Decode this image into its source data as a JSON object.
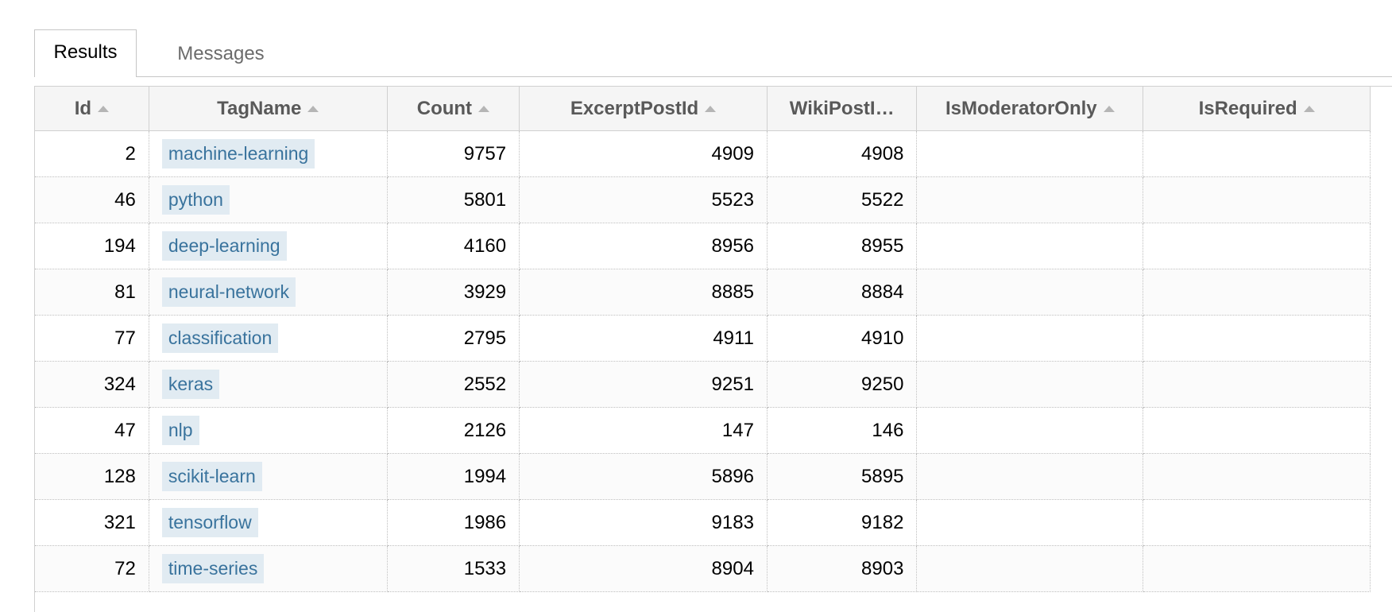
{
  "tabs": [
    {
      "label": "Results",
      "active": true
    },
    {
      "label": "Messages",
      "active": false
    }
  ],
  "columns": [
    "Id",
    "TagName",
    "Count",
    "ExcerptPostId",
    "WikiPostI…",
    "IsModeratorOnly",
    "IsRequired"
  ],
  "rows": [
    {
      "id": "2",
      "tag": "machine-learning",
      "count": "9757",
      "excerpt": "4909",
      "wiki": "4908",
      "mod": "",
      "req": ""
    },
    {
      "id": "46",
      "tag": "python",
      "count": "5801",
      "excerpt": "5523",
      "wiki": "5522",
      "mod": "",
      "req": ""
    },
    {
      "id": "194",
      "tag": "deep-learning",
      "count": "4160",
      "excerpt": "8956",
      "wiki": "8955",
      "mod": "",
      "req": ""
    },
    {
      "id": "81",
      "tag": "neural-network",
      "count": "3929",
      "excerpt": "8885",
      "wiki": "8884",
      "mod": "",
      "req": ""
    },
    {
      "id": "77",
      "tag": "classification",
      "count": "2795",
      "excerpt": "4911",
      "wiki": "4910",
      "mod": "",
      "req": ""
    },
    {
      "id": "324",
      "tag": "keras",
      "count": "2552",
      "excerpt": "9251",
      "wiki": "9250",
      "mod": "",
      "req": ""
    },
    {
      "id": "47",
      "tag": "nlp",
      "count": "2126",
      "excerpt": "147",
      "wiki": "146",
      "mod": "",
      "req": ""
    },
    {
      "id": "128",
      "tag": "scikit-learn",
      "count": "1994",
      "excerpt": "5896",
      "wiki": "5895",
      "mod": "",
      "req": ""
    },
    {
      "id": "321",
      "tag": "tensorflow",
      "count": "1986",
      "excerpt": "9183",
      "wiki": "9182",
      "mod": "",
      "req": ""
    },
    {
      "id": "72",
      "tag": "time-series",
      "count": "1533",
      "excerpt": "8904",
      "wiki": "8903",
      "mod": "",
      "req": ""
    }
  ],
  "colors": {
    "tag_bg": "#e1ebf2",
    "tag_text": "#39739d",
    "header_bg": "#f5f5f5"
  }
}
